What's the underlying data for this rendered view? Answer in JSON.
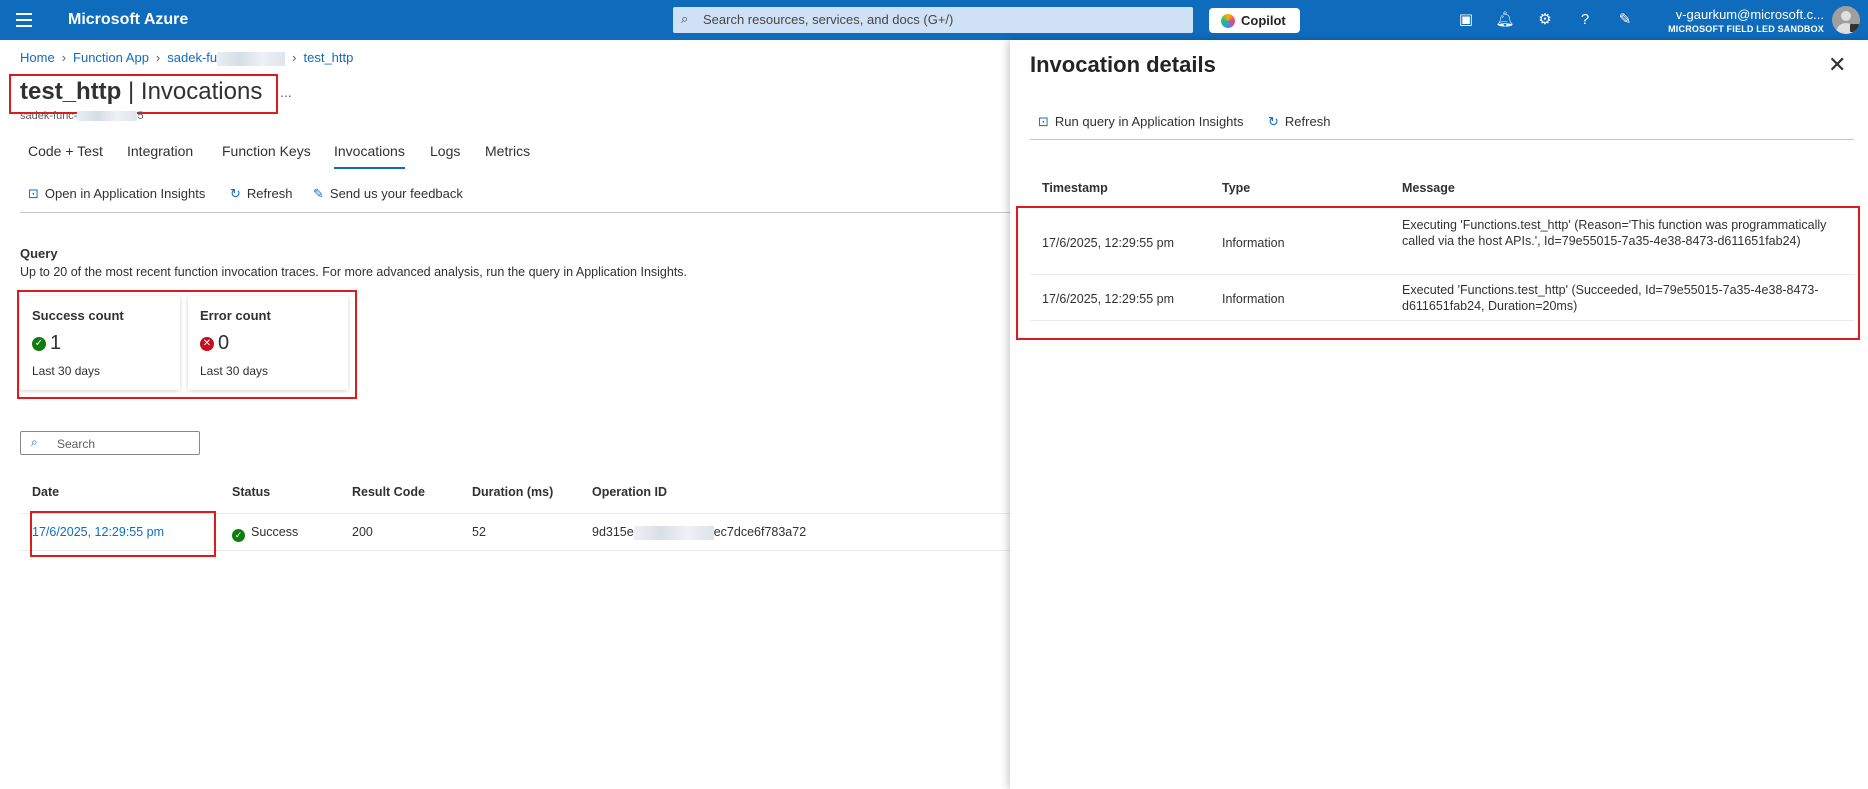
{
  "topbar": {
    "brand": "Microsoft Azure",
    "search_placeholder": "Search resources, services, and docs (G+/)",
    "copilot_label": "Copilot",
    "user": "v-gaurkum@microsoft.c...",
    "org": "MICROSOFT FIELD LED SANDBOX",
    "icons": [
      "cloud-shell-icon",
      "bell-icon",
      "gear-icon",
      "help-icon",
      "feedback-icon"
    ]
  },
  "breadcrumb": {
    "items": [
      "Home",
      "Function App",
      "sadek-fu",
      "test_http"
    ]
  },
  "page": {
    "title_bold": "test_http",
    "title_rest": "| Invocations",
    "more": "...",
    "subtitle_start": "sadek-func-",
    "subtitle_end": "5"
  },
  "tabs": [
    "Code + Test",
    "Integration",
    "Function Keys",
    "Invocations",
    "Logs",
    "Metrics"
  ],
  "active_tab": "Invocations",
  "commands": [
    "Open in Application Insights",
    "Refresh",
    "Send us your feedback"
  ],
  "query": {
    "heading": "Query",
    "description": "Up to 20 of the most recent function invocation traces. For more advanced analysis, run the query in Application Insights."
  },
  "cards": [
    {
      "title": "Success count",
      "value": "1",
      "sub": "Last 30 days",
      "status": "success",
      "color": "#107c10"
    },
    {
      "title": "Error count",
      "value": "0",
      "sub": "Last 30 days",
      "status": "error",
      "color": "#c50f1f"
    }
  ],
  "search": {
    "placeholder": "Search"
  },
  "table": {
    "columns": [
      "Date",
      "Status",
      "Result Code",
      "Duration (ms)",
      "Operation ID"
    ],
    "rows": [
      {
        "date": "17/6/2025, 12:29:55 pm",
        "status": "Success",
        "result_code": "200",
        "duration": "52",
        "op_start": "9d315e",
        "op_end": "ec7dce6f783a72"
      }
    ]
  },
  "panel": {
    "title": "Invocation details",
    "commands": [
      "Run query in Application Insights",
      "Refresh"
    ],
    "columns": [
      "Timestamp",
      "Type",
      "Message"
    ],
    "rows": [
      {
        "timestamp": "17/6/2025, 12:29:55 pm",
        "type": "Information",
        "message": "Executing 'Functions.test_http' (Reason='This function was programmatically called via the host APIs.', Id=79e55015-7a35-4e38-8473-d611651fab24)"
      },
      {
        "timestamp": "17/6/2025, 12:29:55 pm",
        "type": "Information",
        "message": "Executed 'Functions.test_http' (Succeeded, Id=79e55015-7a35-4e38-8473-d611651fab24, Duration=20ms)"
      }
    ]
  },
  "colors": {
    "accent": "#0f6cbd",
    "highlight": "#e0191c"
  }
}
